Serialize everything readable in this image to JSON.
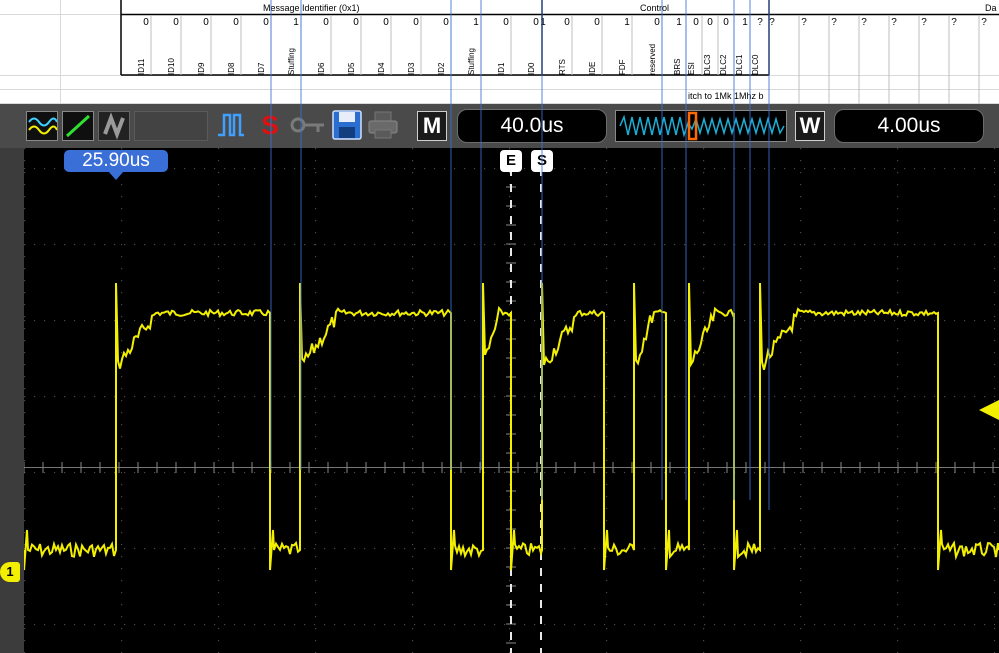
{
  "sheet": {
    "headers": {
      "message_id": "Message Identifier (0x1)",
      "control": "Control",
      "data": "Da"
    },
    "id_values": [
      "0",
      "0",
      "0",
      "0",
      "0",
      "1",
      "0",
      "0",
      "0",
      "0",
      "0",
      "1",
      "0",
      "0",
      "1"
    ],
    "id_labels": [
      "ID11",
      "ID10",
      "ID9",
      "ID8",
      "ID7",
      "Stuffing",
      "ID6",
      "ID5",
      "ID4",
      "ID3",
      "ID2",
      "Stuffing",
      "ID1",
      "ID0"
    ],
    "control_values": [
      "0",
      "0",
      "1",
      "0",
      "1",
      "0",
      "0",
      "0",
      "1",
      "?"
    ],
    "control_labels": [
      "RTS",
      "IDE",
      "FDF",
      "reserved",
      "BRS",
      "ESI",
      "DLC3",
      "DLC2",
      "DLC1",
      "DLC0"
    ],
    "data_values": [
      "?",
      "?",
      "?",
      "?",
      "?",
      "?",
      "?",
      "?"
    ],
    "note": "itch to 1Mk 1Mhz b"
  },
  "scope": {
    "timebase": "40.0us",
    "window": "4.00us",
    "cursor_time": "25.90us",
    "m_label": "M",
    "w_label": "W",
    "marker_e": "E",
    "marker_s": "S",
    "trigger_label": "S",
    "channel_label": "1",
    "trace_color": "#f2ef00",
    "accent_blue": "#3b6fd8"
  }
}
